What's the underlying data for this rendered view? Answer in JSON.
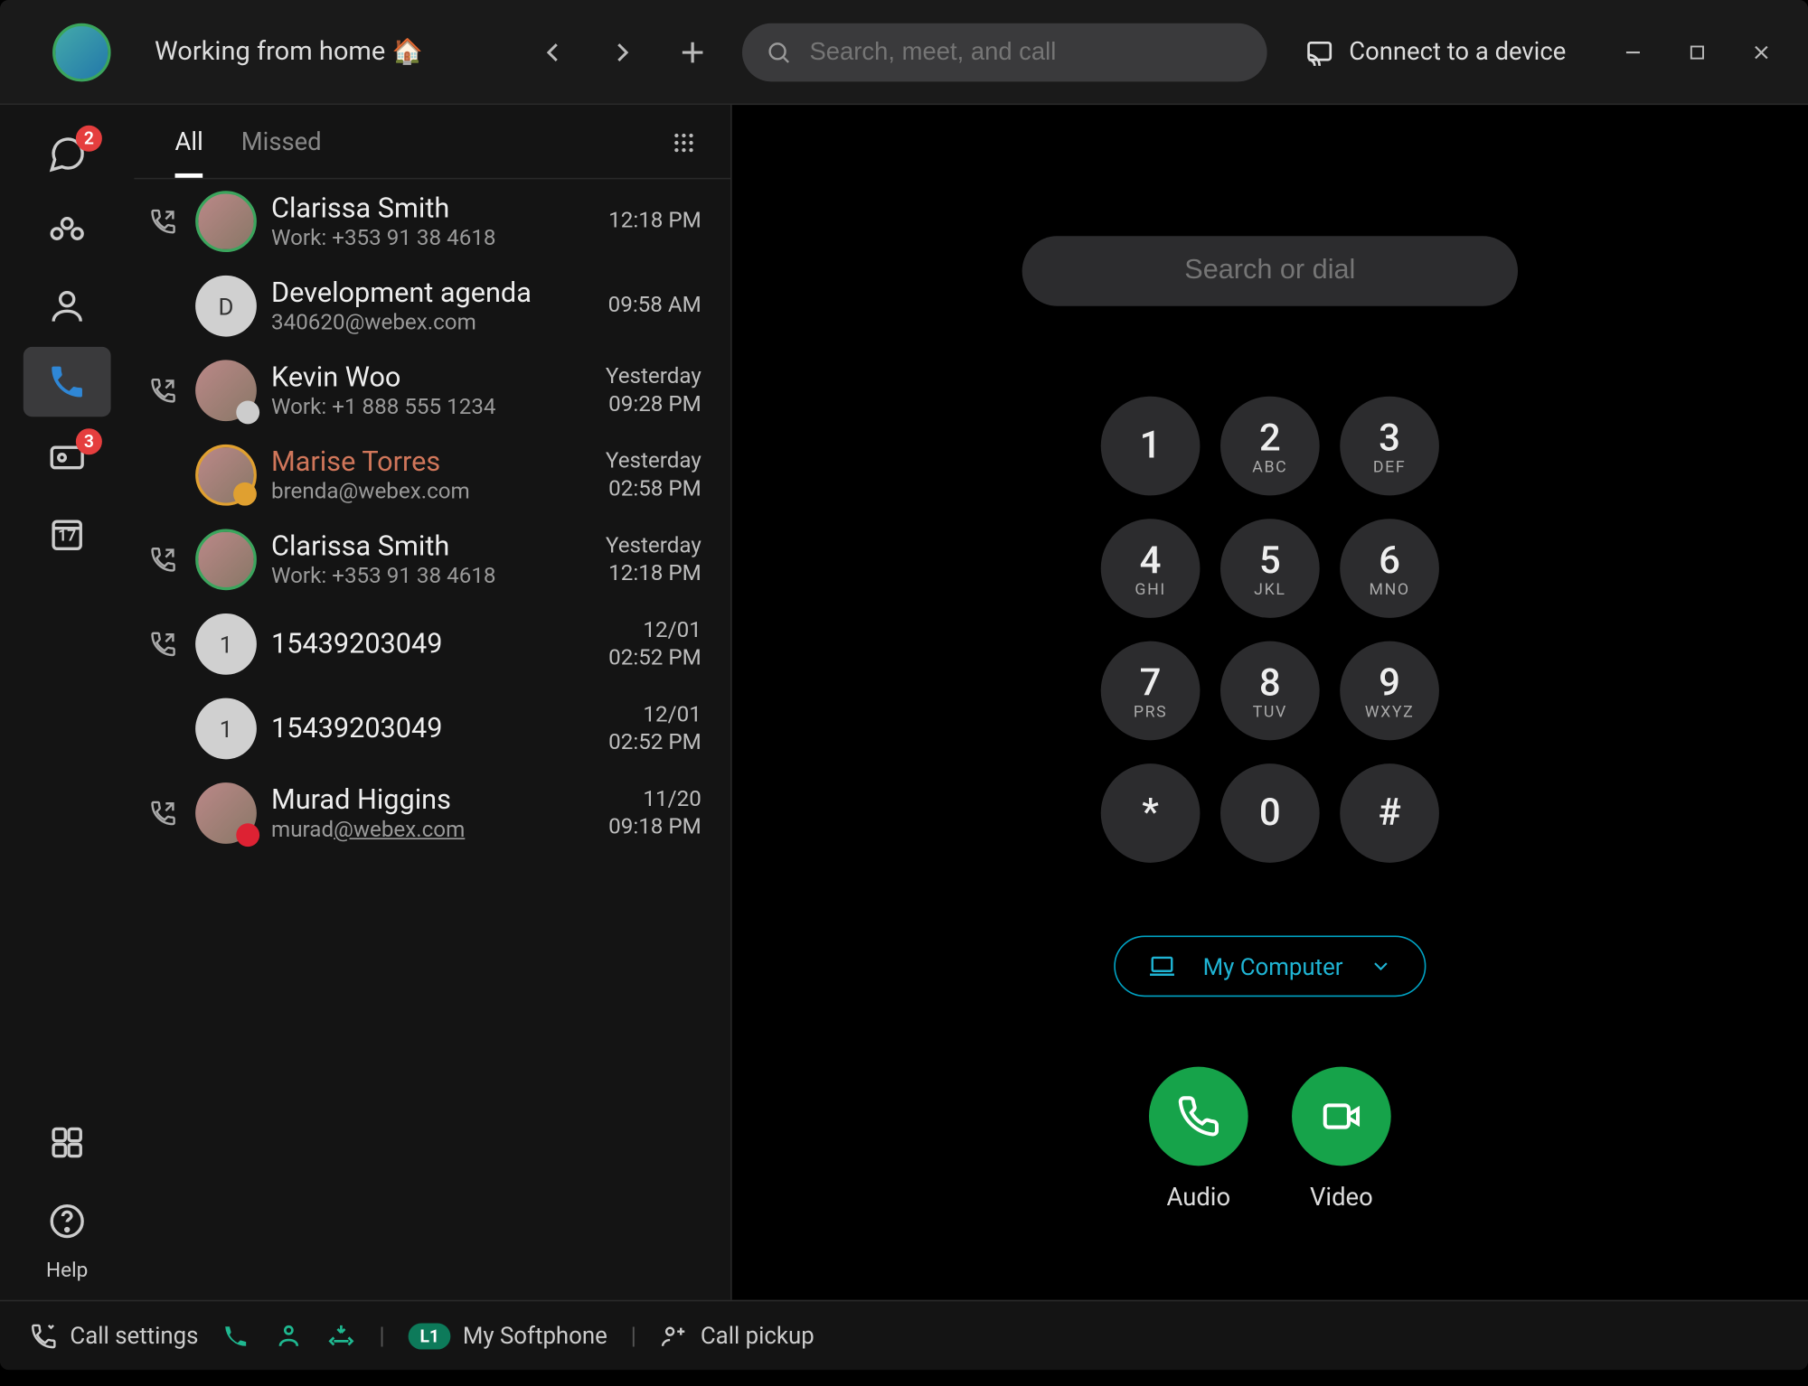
{
  "titlebar": {
    "status_text": "Working from home",
    "status_emoji": "🏠",
    "search_placeholder": "Search, meet, and call",
    "connect_label": "Connect to a device"
  },
  "rail": {
    "messaging_badge": "2",
    "voicemail_badge": "3",
    "calendar_day": "17",
    "help_label": "Help"
  },
  "tabs": {
    "all": "All",
    "missed": "Missed"
  },
  "calls": [
    {
      "icon": "outgoing",
      "avatar": "img",
      "ring": "green",
      "name": "Clarissa Smith",
      "sub_prefix": "Work: ",
      "sub": "+353 91 38 4618",
      "date": "",
      "time": "12:18 PM",
      "missed": false
    },
    {
      "icon": "",
      "avatar": "D",
      "name": "Development agenda",
      "sub_prefix": "",
      "sub": "340620@webex.com",
      "date": "",
      "time": "09:58 AM",
      "missed": false
    },
    {
      "icon": "outgoing",
      "avatar": "img",
      "ring": "",
      "sub_badge": "clock",
      "name": "Kevin Woo",
      "sub_prefix": "Work: ",
      "sub": "+1 888 555 1234",
      "date": "Yesterday",
      "time": "09:28 PM",
      "missed": false
    },
    {
      "icon": "",
      "avatar": "img",
      "ring": "yellow",
      "sub_badge": "video",
      "name": "Marise Torres",
      "sub_prefix": "",
      "sub": "brenda@webex.com",
      "date": "Yesterday",
      "time": "02:58 PM",
      "missed": true
    },
    {
      "icon": "outgoing",
      "avatar": "img",
      "ring": "green",
      "name": "Clarissa Smith",
      "sub_prefix": "Work: ",
      "sub": "+353 91 38 4618",
      "date": "Yesterday",
      "time": "12:18 PM",
      "missed": false
    },
    {
      "icon": "outgoing",
      "avatar": "1",
      "name": "15439203049",
      "sub_prefix": "",
      "sub": "",
      "date": "12/01",
      "time": "02:52 PM",
      "missed": false
    },
    {
      "icon": "",
      "avatar": "1",
      "name": "15439203049",
      "sub_prefix": "",
      "sub": "",
      "date": "12/01",
      "time": "02:52 PM",
      "missed": false
    },
    {
      "icon": "outgoing",
      "avatar": "img",
      "sub_badge": "red",
      "name": "Murad Higgins",
      "sub_prefix": "",
      "sub": "murad",
      "sub_link": "@webex.com",
      "date": "11/20",
      "time": "09:18 PM",
      "missed": false
    }
  ],
  "dial": {
    "search_placeholder": "Search or dial",
    "keys": [
      {
        "d": "1",
        "l": ""
      },
      {
        "d": "2",
        "l": "ABC"
      },
      {
        "d": "3",
        "l": "DEF"
      },
      {
        "d": "4",
        "l": "GHI"
      },
      {
        "d": "5",
        "l": "JKL"
      },
      {
        "d": "6",
        "l": "MNO"
      },
      {
        "d": "7",
        "l": "PRS"
      },
      {
        "d": "8",
        "l": "TUV"
      },
      {
        "d": "9",
        "l": "WXYZ"
      },
      {
        "d": "*",
        "l": ""
      },
      {
        "d": "0",
        "l": ""
      },
      {
        "d": "#",
        "l": ""
      }
    ],
    "device_label": "My Computer",
    "audio_label": "Audio",
    "video_label": "Video"
  },
  "footer": {
    "call_settings": "Call settings",
    "line_pill": "L1",
    "softphone": "My Softphone",
    "call_pickup": "Call pickup"
  }
}
